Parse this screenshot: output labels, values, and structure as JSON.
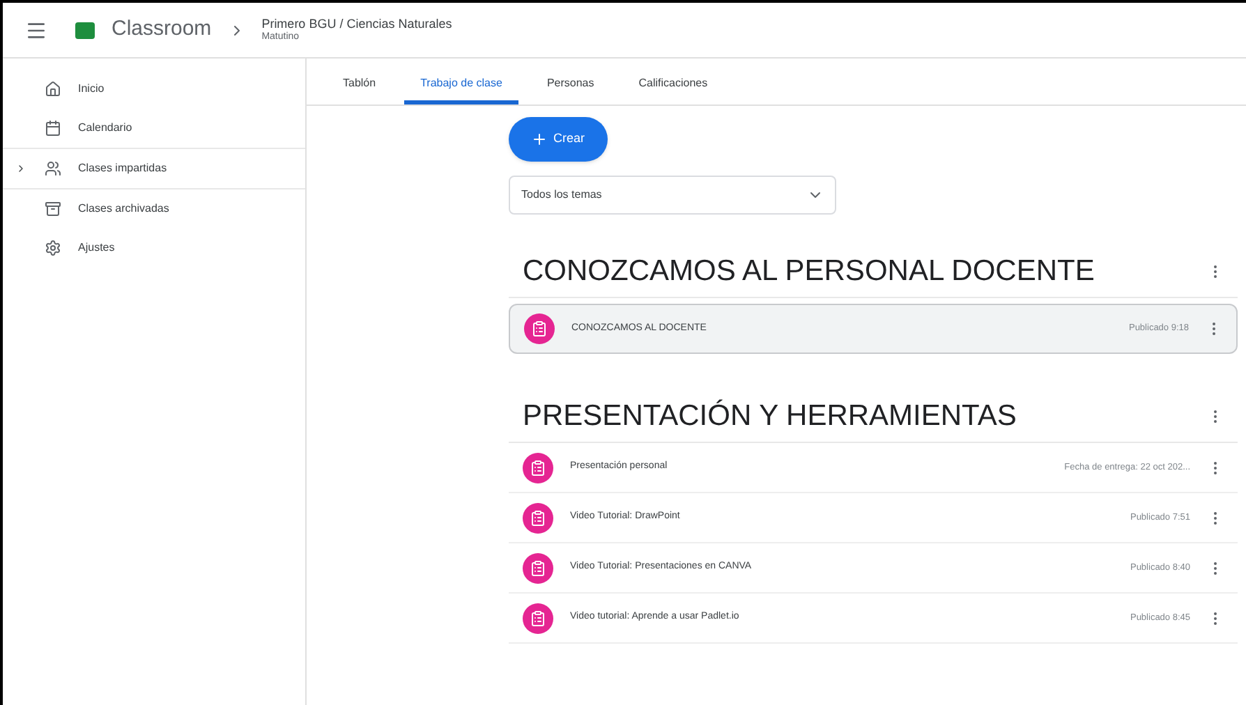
{
  "header": {
    "app_name": "Classroom",
    "class_title": "Primero BGU / Ciencias Naturales",
    "class_subtitle": "Matutino"
  },
  "sidebar": {
    "items": [
      {
        "label": "Inicio",
        "kind": "home",
        "selected": false,
        "expandable": false
      },
      {
        "label": "Calendario",
        "kind": "calendar",
        "selected": false,
        "expandable": false
      },
      {
        "label": "Clases impartidas",
        "kind": "people",
        "selected": false,
        "expandable": true
      },
      {
        "label": "Clases archivadas",
        "kind": "archive",
        "selected": false,
        "expandable": false
      },
      {
        "label": "Ajustes",
        "kind": "settings",
        "selected": false,
        "expandable": false
      }
    ]
  },
  "tabs": [
    {
      "label": "Tablón",
      "selected": false
    },
    {
      "label": "Trabajo de clase",
      "selected": true
    },
    {
      "label": "Personas",
      "selected": false
    },
    {
      "label": "Calificaciones",
      "selected": false
    }
  ],
  "create_button": {
    "label": "Crear"
  },
  "topic_filter": {
    "value": "Todos los temas"
  },
  "topics": [
    {
      "title": "CONOZCAMOS AL PERSONAL DOCENTE",
      "items": [
        {
          "title": "CONOZCAMOS AL DOCENTE",
          "meta": "Publicado 9:18",
          "highlighted": true
        }
      ]
    },
    {
      "title": "PRESENTACIÓN Y HERRAMIENTAS",
      "items": [
        {
          "title": "Presentación personal",
          "meta": "Fecha de entrega: 22 oct 202...",
          "highlighted": false
        },
        {
          "title": "Video Tutorial: DrawPoint",
          "meta": "Publicado 7:51",
          "highlighted": false
        },
        {
          "title": "Video Tutorial: Presentaciones en CANVA",
          "meta": "Publicado 8:40",
          "highlighted": false
        },
        {
          "title": "Video tutorial: Aprende a usar Padlet.io",
          "meta": "Publicado 8:45",
          "highlighted": false
        }
      ]
    }
  ]
}
